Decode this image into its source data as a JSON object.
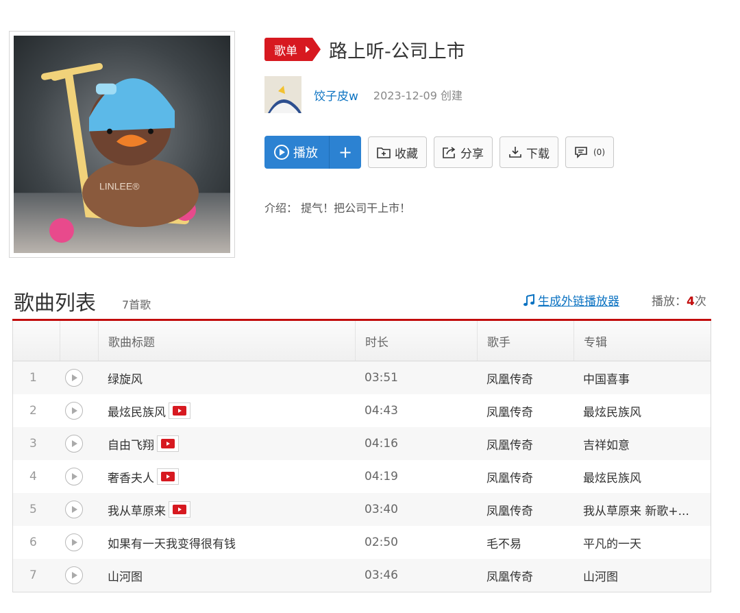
{
  "playlist": {
    "tag_label": "歌单",
    "title": "路上听-公司上市",
    "creator": "饺子皮w",
    "created": "2023-12-09 创建",
    "intro": "介绍： 提气！把公司干上市！"
  },
  "actions": {
    "play": "播放",
    "add": "+",
    "collect": "收藏",
    "share": "分享",
    "download": "下载",
    "comment_count": "(0)"
  },
  "list": {
    "title": "歌曲列表",
    "count": "7首歌",
    "ext_link": "生成外链播放器",
    "play_label": "播放：",
    "play_times": "4",
    "play_unit": "次",
    "columns": [
      "",
      "",
      "歌曲标题",
      "时长",
      "歌手",
      "专辑"
    ],
    "rows": [
      {
        "idx": "1",
        "title": "绿旋风",
        "mv": false,
        "duration": "03:51",
        "artist": "凤凰传奇",
        "album": "中国喜事"
      },
      {
        "idx": "2",
        "title": "最炫民族风",
        "mv": true,
        "duration": "04:43",
        "artist": "凤凰传奇",
        "album": "最炫民族风"
      },
      {
        "idx": "3",
        "title": "自由飞翔",
        "mv": true,
        "duration": "04:16",
        "artist": "凤凰传奇",
        "album": "吉祥如意"
      },
      {
        "idx": "4",
        "title": "奢香夫人",
        "mv": true,
        "duration": "04:19",
        "artist": "凤凰传奇",
        "album": "最炫民族风"
      },
      {
        "idx": "5",
        "title": "我从草原来",
        "mv": true,
        "duration": "03:40",
        "artist": "凤凰传奇",
        "album": "我从草原来 新歌+..."
      },
      {
        "idx": "6",
        "title": "如果有一天我变得很有钱",
        "mv": false,
        "duration": "02:50",
        "artist": "毛不易",
        "album": "平凡的一天"
      },
      {
        "idx": "7",
        "title": "山河图",
        "mv": false,
        "duration": "03:46",
        "artist": "凤凰传奇",
        "album": "山河图"
      }
    ]
  },
  "icons": {
    "play": "play-circle-icon",
    "collect": "folder-plus-icon",
    "share": "share-icon",
    "download": "download-icon",
    "comment": "comment-icon",
    "mv": "mv-icon",
    "music_note": "music-note-icon"
  },
  "colors": {
    "accent_red": "#c20c0c",
    "link_blue": "#0c73c2",
    "play_blue": "#2c82d2"
  }
}
